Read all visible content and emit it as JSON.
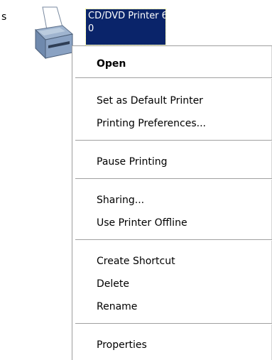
{
  "desktop": {
    "left_fragment": "s",
    "icon": {
      "name": "printer-icon",
      "label_line1": "CD/DVD Printer 6",
      "label_line2": "0"
    }
  },
  "menu": {
    "items": [
      {
        "label": "Open",
        "bold": true
      },
      {
        "label": "Set as Default Printer"
      },
      {
        "label": "Printing Preferences..."
      },
      {
        "label": "Pause Printing"
      },
      {
        "label": "Sharing..."
      },
      {
        "label": "Use Printer Offline"
      },
      {
        "label": "Create Shortcut"
      },
      {
        "label": "Delete"
      },
      {
        "label": "Rename"
      },
      {
        "label": "Properties"
      }
    ]
  },
  "colors": {
    "selection": "#0a246a",
    "menu_background": "#ffffff",
    "separator": "#a0a0a0"
  }
}
